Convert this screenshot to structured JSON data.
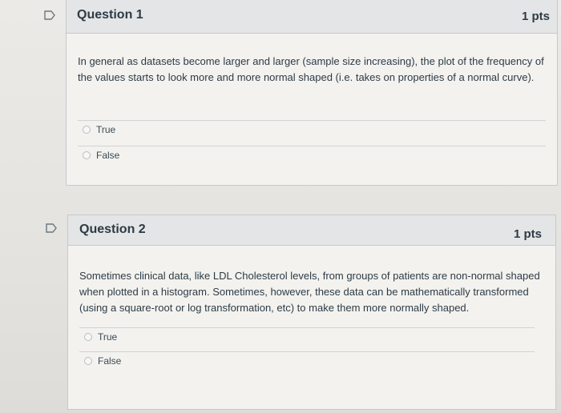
{
  "questions": [
    {
      "title": "Question 1",
      "points": "1 pts",
      "text": "In general as datasets become larger and larger (sample size increasing), the plot of the frequency of the values starts to look more and more normal shaped (i.e. takes on properties of a normal curve).",
      "answers": [
        {
          "label": "True"
        },
        {
          "label": "False"
        }
      ]
    },
    {
      "title": "Question 2",
      "points": "1 pts",
      "text": "Sometimes clinical data, like LDL Cholesterol levels, from groups of patients are non-normal shaped when plotted in a histogram. Sometimes, however, these data can be mathematically transformed (using a square-root or log transformation, etc) to make them more normally shaped.",
      "answers": [
        {
          "label": "True"
        },
        {
          "label": "False"
        }
      ]
    }
  ],
  "icons": {
    "flag": "flag-question-icon"
  },
  "colors": {
    "text": "#2d3b45",
    "header_bg": "#e4e5e6",
    "card_bg": "#f3f2ef",
    "border": "#c5c9cc"
  }
}
